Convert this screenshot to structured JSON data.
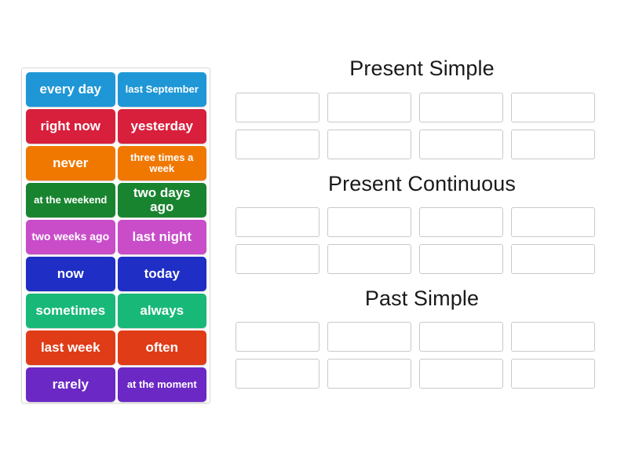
{
  "activity": {
    "type": "group-sort",
    "title": "Time expressions group sort"
  },
  "tray": {
    "name": "word-tile-tray",
    "tiles": [
      {
        "label": "every day",
        "color": "#1f97d6",
        "lines": 1
      },
      {
        "label": "last September",
        "color": "#1f97d6",
        "lines": 2
      },
      {
        "label": "right now",
        "color": "#d81f3c",
        "lines": 1
      },
      {
        "label": "yesterday",
        "color": "#d81f3c",
        "lines": 1
      },
      {
        "label": "never",
        "color": "#f07800",
        "lines": 1
      },
      {
        "label": "three times a week",
        "color": "#f07800",
        "lines": 2
      },
      {
        "label": "at the weekend",
        "color": "#18842f",
        "lines": 2
      },
      {
        "label": "two days ago",
        "color": "#18842f",
        "lines": 1
      },
      {
        "label": "two weeks ago",
        "color": "#c94cc9",
        "lines": 1
      },
      {
        "label": "last night",
        "color": "#c94cc9",
        "lines": 1
      },
      {
        "label": "now",
        "color": "#1f2ec4",
        "lines": 1
      },
      {
        "label": "today",
        "color": "#1f2ec4",
        "lines": 1
      },
      {
        "label": "sometimes",
        "color": "#18b878",
        "lines": 1
      },
      {
        "label": "always",
        "color": "#18b878",
        "lines": 1
      },
      {
        "label": "last week",
        "color": "#e03c18",
        "lines": 1
      },
      {
        "label": "often",
        "color": "#e03c18",
        "lines": 1
      },
      {
        "label": "rarely",
        "color": "#6b28c4",
        "lines": 1
      },
      {
        "label": "at the moment",
        "color": "#6b28c4",
        "lines": 2
      }
    ]
  },
  "categories": [
    {
      "title": "Present Simple",
      "slots": 8
    },
    {
      "title": "Present Continuous",
      "slots": 8
    },
    {
      "title": "Past Simple",
      "slots": 8
    }
  ],
  "colors": {
    "background": "#ffffff",
    "tray_border": "#d9d9d9",
    "slot_border": "#c9c9c9",
    "title_text": "#1a1a1a",
    "tile_text": "#ffffff"
  }
}
